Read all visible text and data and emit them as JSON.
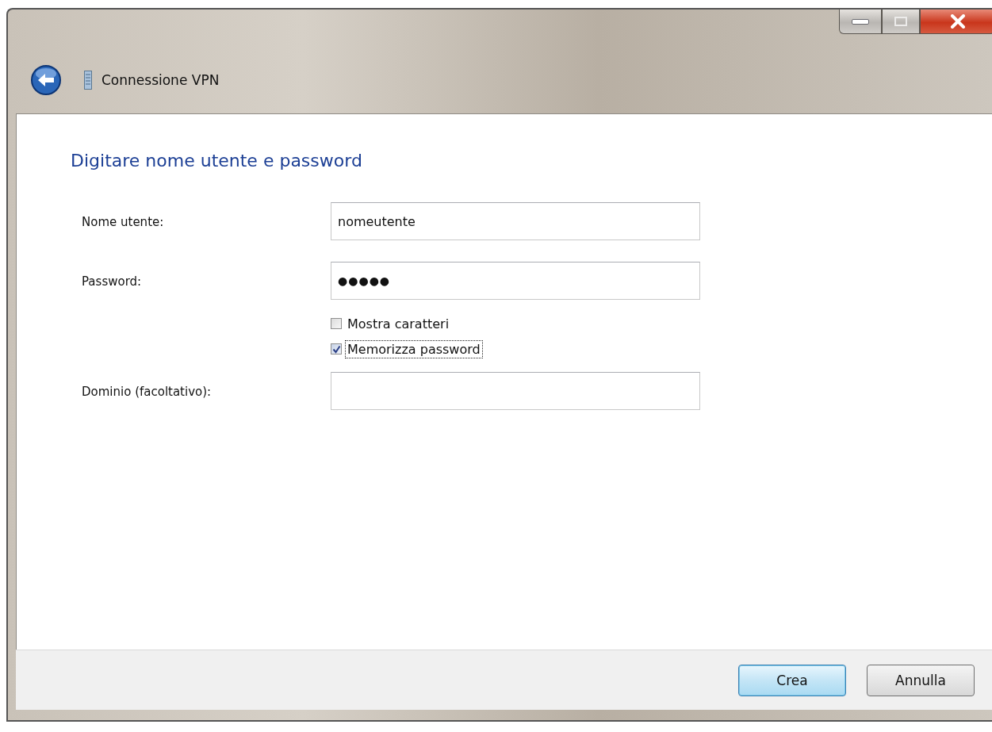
{
  "window": {
    "title": "Connessione VPN"
  },
  "heading": "Digitare nome utente e password",
  "fields": [
    {
      "kind": "text",
      "label": "Nome utente:",
      "value": "nomeutente"
    },
    {
      "kind": "password",
      "label": "Password:",
      "value": "●●●●●"
    },
    {
      "kind": "checkbox",
      "label": "Mostra caratteri",
      "checked": false,
      "focused": false
    },
    {
      "kind": "checkbox",
      "label": "Memorizza password",
      "checked": true,
      "focused": true
    },
    {
      "kind": "text",
      "label": "Dominio (facoltativo):"
    }
  ],
  "buttons": [
    {
      "label": "Crea",
      "default": true
    },
    {
      "label": "Annulla",
      "default": false
    }
  ]
}
